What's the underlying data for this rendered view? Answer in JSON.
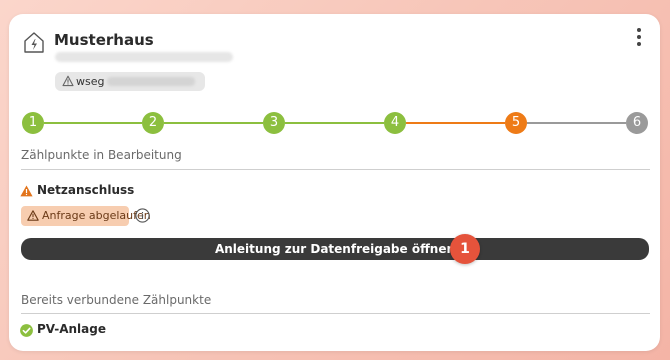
{
  "property": {
    "title": "Musterhaus",
    "chip_label": "wseg"
  },
  "stepper": {
    "steps": [
      "1",
      "2",
      "3",
      "4",
      "5",
      "6"
    ],
    "active_step": 5,
    "colors": {
      "done": "#8cbf3f",
      "active": "#ee7b17",
      "pending": "#9a9a9a"
    }
  },
  "sections": {
    "in_progress_label": "Zählpunkte in Bearbeitung",
    "connected_label": "Bereits verbundene Zählpunkte"
  },
  "netzanschluss": {
    "label": "Netzanschluss",
    "status_badge": "Anfrage abgelaufen"
  },
  "actions": {
    "guide_button": "Anleitung zur Datenfreigabe öffnen",
    "marker_number": "1"
  },
  "connected": {
    "items": [
      "PV-Anlage"
    ]
  },
  "icons": {
    "house": "house-bolt-icon",
    "more": "more-vertical-icon",
    "warning": "warning-icon",
    "info": "info-icon",
    "check": "check-circle-icon"
  }
}
